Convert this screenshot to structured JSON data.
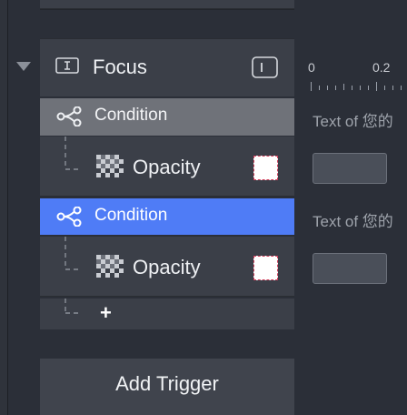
{
  "focus": {
    "label": "Focus",
    "icon": "text-cursor-icon",
    "toggle_icon": "panel-toggle-icon"
  },
  "ruler": {
    "ticks": [
      "0",
      "0.2"
    ]
  },
  "rows": [
    {
      "condition_label": "Condition",
      "condition_state": "dimmed",
      "property_label": "Opacity",
      "side_text": "Text of 您的"
    },
    {
      "condition_label": "Condition",
      "condition_state": "selected",
      "property_label": "Opacity",
      "side_text": "Text of 您的"
    }
  ],
  "add": {
    "plus_label": "+",
    "add_trigger_label": "Add Trigger"
  },
  "colors": {
    "selected": "#4f7cf6",
    "dimmed": "#6f7279",
    "panel": "#3b3f48",
    "background": "#2b2f38"
  }
}
